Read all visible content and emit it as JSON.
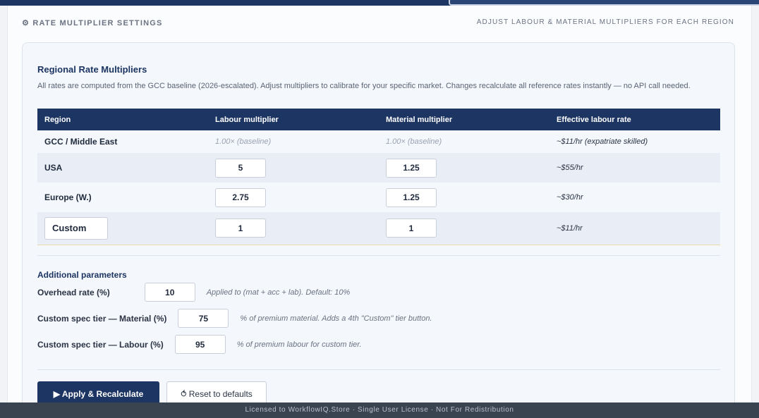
{
  "section": {
    "title": "⚙ RATE MULTIPLIER SETTINGS",
    "hint": "ADJUST LABOUR & MATERIAL MULTIPLIERS FOR EACH REGION"
  },
  "card": {
    "title": "Regional Rate Multipliers",
    "description": "All rates are computed from the GCC baseline (2026-escalated). Adjust multipliers to calibrate for your specific market. Changes recalculate all reference rates instantly — no API call needed."
  },
  "table": {
    "headers": [
      "Region",
      "Labour multiplier",
      "Material multiplier",
      "Effective labour rate"
    ],
    "rows": [
      {
        "region": "GCC / Middle East",
        "labour": "1.00× (baseline)",
        "material": "1.00× (baseline)",
        "effective": "~$11/hr (expatriate skilled)"
      },
      {
        "region": "USA",
        "labour": "5",
        "material": "1.25",
        "effective": "~$55/hr"
      },
      {
        "region": "Europe (W.)",
        "labour": "2.75",
        "material": "1.25",
        "effective": "~$30/hr"
      },
      {
        "region": "Custom",
        "labour": "1",
        "material": "1",
        "effective": "~$11/hr"
      }
    ]
  },
  "additional": {
    "title": "Additional parameters",
    "params": [
      {
        "label": "Overhead rate (%)",
        "value": "10",
        "note": "Applied to (mat + acc + lab). Default: 10%"
      },
      {
        "label": "Custom spec tier — Material (%)",
        "value": "75",
        "note": "% of premium material. Adds a 4th \"Custom\" tier button."
      },
      {
        "label": "Custom spec tier — Labour (%)",
        "value": "95",
        "note": "% of premium labour for custom tier."
      }
    ]
  },
  "buttons": {
    "apply": "▶ Apply & Recalculate",
    "reset": "⥀ Reset to defaults"
  },
  "footer": {
    "text": "Licensed to WorkflowIQ.Store  ·  Single User License  ·  Not For Redistribution"
  },
  "colors": {
    "accent": "#1c3563",
    "footer_bg": "#3a4350"
  }
}
